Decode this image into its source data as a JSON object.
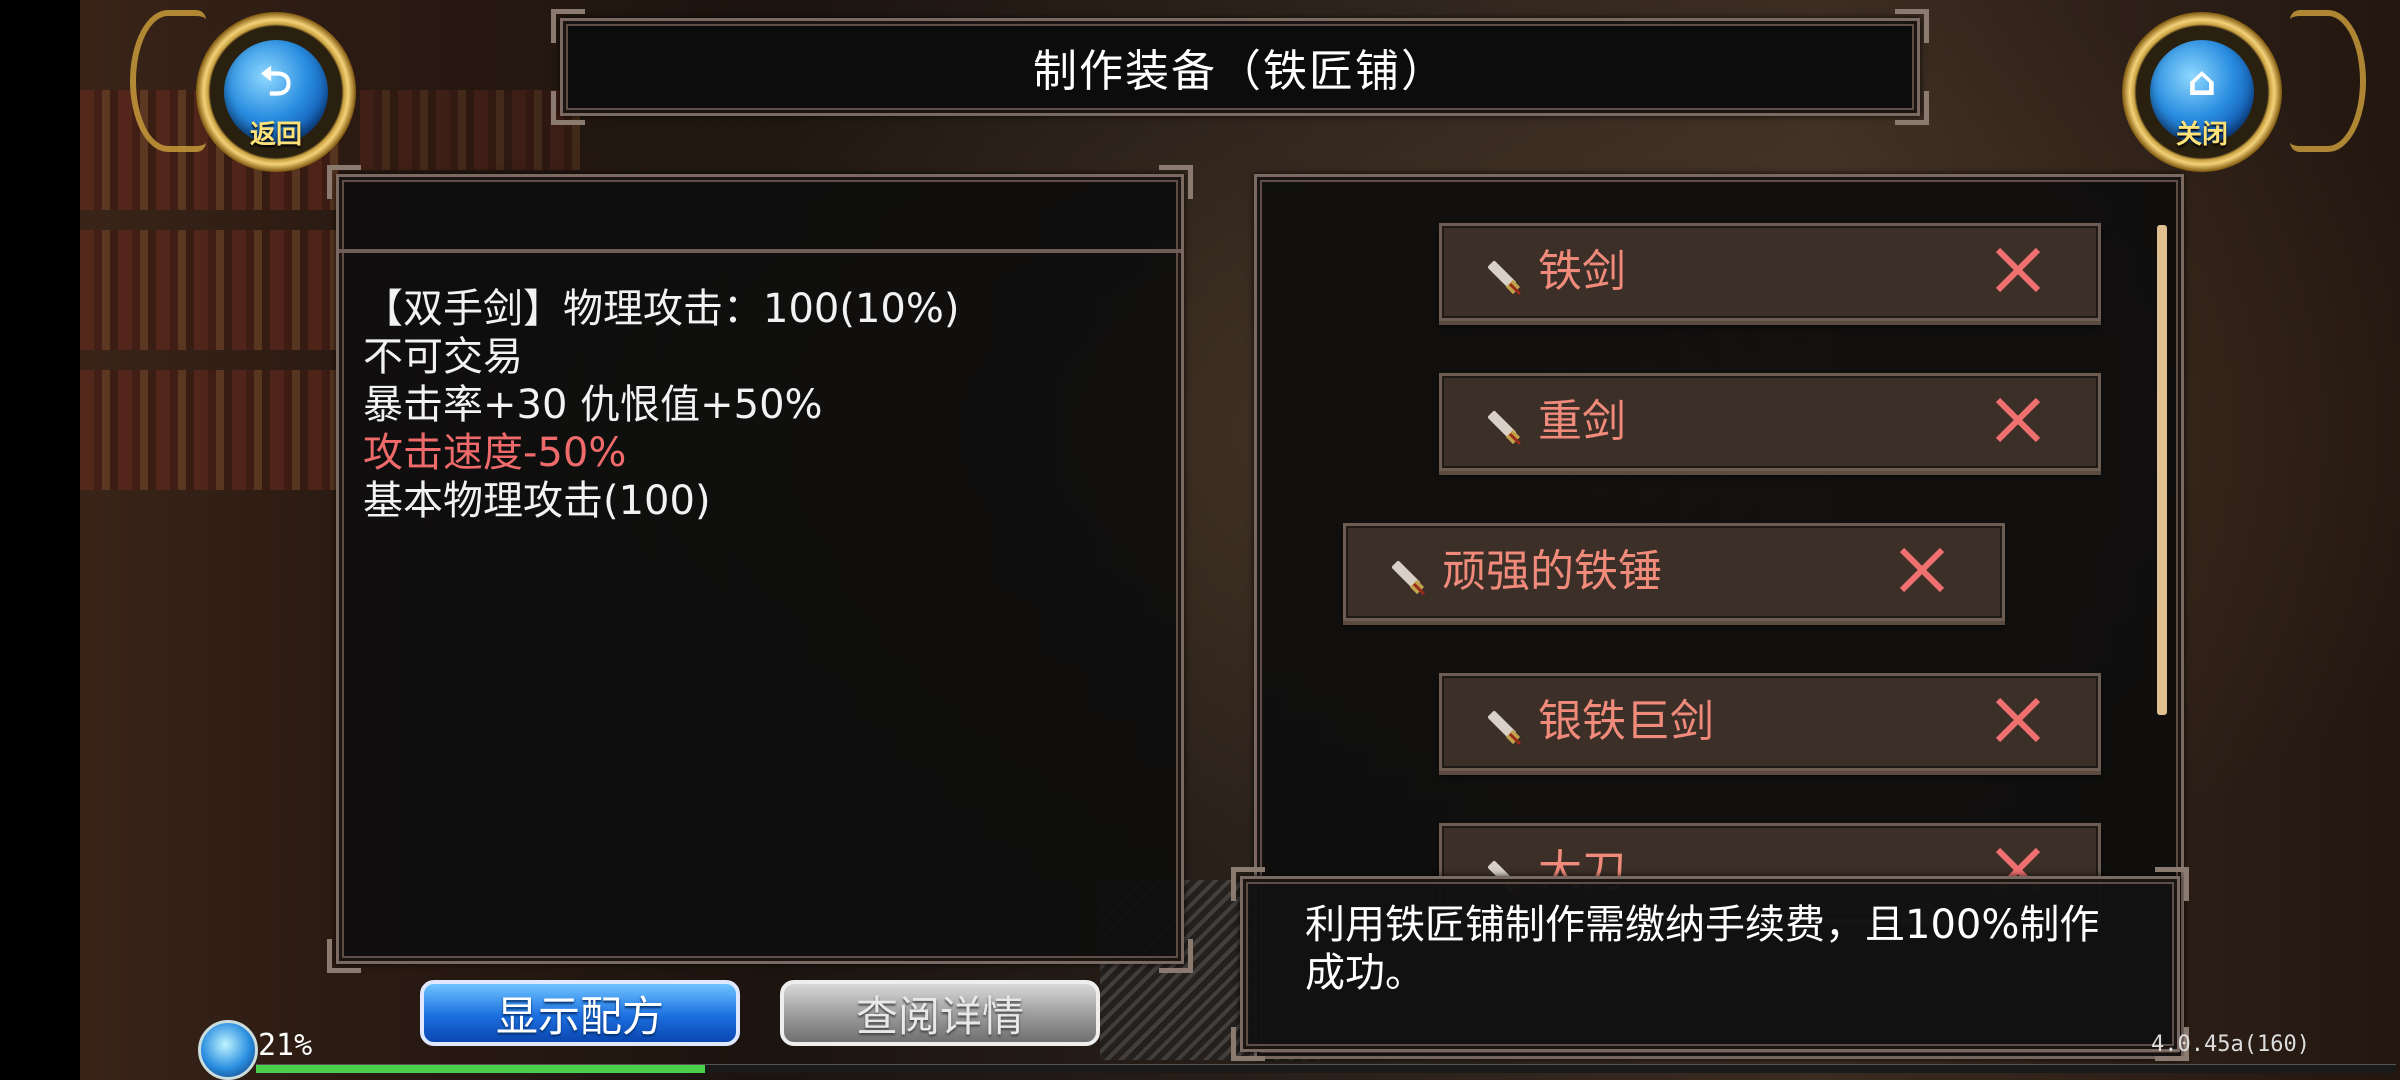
{
  "title": "制作装备（铁匠铺）",
  "nav": {
    "back_label": "返回",
    "back_icon": "return-arrow-icon",
    "close_label": "关闭",
    "close_icon": "home-icon"
  },
  "item_info": {
    "lines": [
      {
        "text": "【双手剑】物理攻击：100(10%)",
        "color": "#f2f2f2"
      },
      {
        "text": "不可交易",
        "color": "#f2f2f2"
      },
      {
        "text": "暴击率+30 仇恨值+50%",
        "color": "#f2f2f2"
      },
      {
        "text": "攻击速度-50%",
        "color": "#ef6a6a"
      },
      {
        "text": "基本物理攻击(100)",
        "color": "#f2f2f2"
      }
    ]
  },
  "recipe_list": {
    "items": [
      {
        "name": "铁剑",
        "icon": "sword-icon",
        "selected": false
      },
      {
        "name": "重剑",
        "icon": "sword-icon",
        "selected": false
      },
      {
        "name": "顽强的铁锤",
        "icon": "sword-icon",
        "selected": true
      },
      {
        "name": "银铁巨剑",
        "icon": "sword-icon",
        "selected": false
      },
      {
        "name": "大刀",
        "icon": "sword-icon",
        "selected": false
      }
    ],
    "unavailable_icon": "close-x-icon"
  },
  "message": "利用铁匠铺制作需缴纳手续费，且100%制作成功。",
  "buttons": {
    "show_recipe": "显示配方",
    "view_details": "查阅详情"
  },
  "hud": {
    "progress_label": "21%",
    "progress_fraction": 0.21,
    "version": "4.0.45a(160)"
  },
  "colors": {
    "accent_gold": "#f3d27a",
    "item_name": "#f08a7a",
    "negative_stat": "#ef6a6a",
    "button_blue": "#1c6fe0"
  }
}
